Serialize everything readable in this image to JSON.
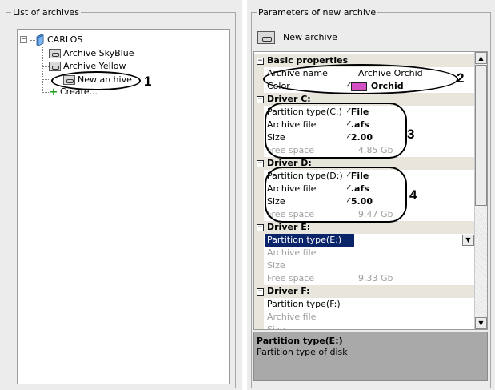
{
  "left_panel": {
    "group_title": "List of archives",
    "tree": {
      "root_label": "CARLOS",
      "items": [
        {
          "label": "Archive SkyBlue"
        },
        {
          "label": "Archive Yellow"
        },
        {
          "label": "New archive"
        },
        {
          "label": "Create..."
        }
      ],
      "expander_symbol": "−"
    }
  },
  "right_panel": {
    "group_title": "Parameters of new archive",
    "archive_header": "New archive",
    "grid": {
      "categories": [
        {
          "label": "Basic properties"
        },
        {
          "label": "Driver C:"
        },
        {
          "label": "Driver D:"
        },
        {
          "label": "Driver E:"
        },
        {
          "label": "Driver F:"
        }
      ],
      "rows": [
        {
          "name": "Archive name",
          "value": "Archive Orchid"
        },
        {
          "name": "Color",
          "value": "Orchid",
          "swatch": "#d44fc4"
        },
        {
          "name": "Partition type(C:)",
          "value": "File"
        },
        {
          "name": "Archive file",
          "value": ".afs"
        },
        {
          "name": "Size",
          "value": "2.00"
        },
        {
          "name": "Free space",
          "value": "4.85 Gb"
        },
        {
          "name": "Partition type(D:)",
          "value": "File"
        },
        {
          "name": "Archive file",
          "value": ".afs"
        },
        {
          "name": "Size",
          "value": "5.00"
        },
        {
          "name": "Free space",
          "value": "9.47 Gb"
        },
        {
          "name": "Partition type(E:)",
          "value": ""
        },
        {
          "name": "Archive file",
          "value": ""
        },
        {
          "name": "Size",
          "value": ""
        },
        {
          "name": "Free space",
          "value": "9.33 Gb"
        },
        {
          "name": "Partition type(F:)",
          "value": ""
        },
        {
          "name": "Archive file",
          "value": ""
        },
        {
          "name": "Size",
          "value": ""
        }
      ],
      "pen_symbol": "⁄"
    },
    "description": {
      "title": "Partition type(E:)",
      "text": "Partition type of disk"
    }
  },
  "annotations": [
    "1",
    "2",
    "3",
    "4"
  ],
  "colors": {
    "panel_bg": "#ececec",
    "category_bg": "#e8e6dc",
    "selection_bg": "#0a246a",
    "description_bg": "#a9a9a9",
    "orchid": "#d44fc4"
  }
}
